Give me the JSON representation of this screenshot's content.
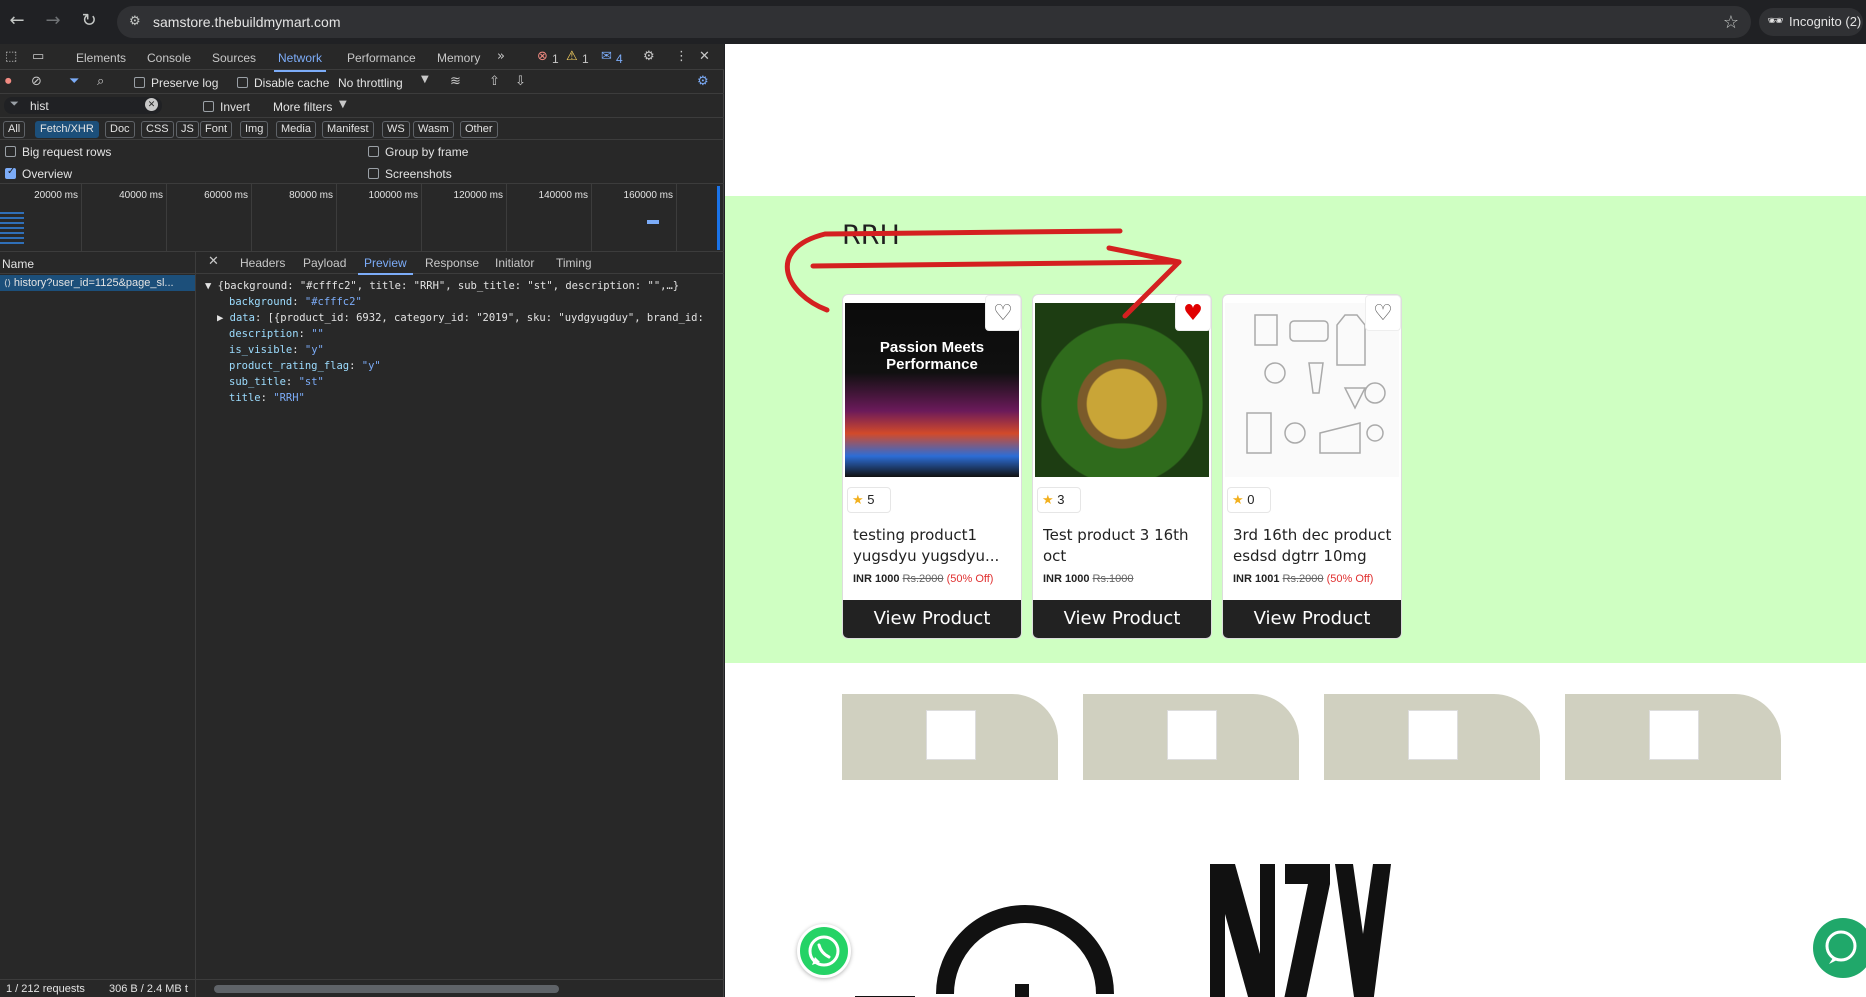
{
  "browser": {
    "url": "samstore.thebuildmymart.com",
    "incognito_label": "Incognito (2)"
  },
  "devtools": {
    "tabs": [
      "Elements",
      "Console",
      "Sources",
      "Network",
      "Performance",
      "Memory"
    ],
    "active_tab": "Network",
    "errors": "1",
    "warnings": "1",
    "messages": "4",
    "toolbar": {
      "preserve_log": "Preserve log",
      "disable_cache": "Disable cache",
      "throttling": "No throttling"
    },
    "filter": {
      "value": "hist",
      "invert": "Invert",
      "more_filters": "More filters"
    },
    "type_filters": [
      "All",
      "Fetch/XHR",
      "Doc",
      "CSS",
      "JS",
      "Font",
      "Img",
      "Media",
      "Manifest",
      "WS",
      "Wasm",
      "Other"
    ],
    "active_type": "Fetch/XHR",
    "options": {
      "big_request_rows": "Big request rows",
      "group_by_frame": "Group by frame",
      "overview": "Overview",
      "screenshots": "Screenshots"
    },
    "overview_ticks": [
      "20000 ms",
      "40000 ms",
      "60000 ms",
      "80000 ms",
      "100000 ms",
      "120000 ms",
      "140000 ms",
      "160000 ms"
    ],
    "name_header": "Name",
    "request_name": "history?user_id=1125&page_sl...",
    "detail_tabs": [
      "Headers",
      "Payload",
      "Preview",
      "Response",
      "Initiator",
      "Timing"
    ],
    "active_detail_tab": "Preview",
    "preview": {
      "summary": "{background: \"#cfffc2\", title: \"RRH\", sub_title: \"st\", description: \"\",…}",
      "lines": [
        {
          "key": "background",
          "value": "\"#cfffc2\""
        },
        {
          "key": "data",
          "value": "[{product_id: 6932, category_id: \"2019\", sku: \"uydgyugduy\", brand_id:"
        },
        {
          "key": "description",
          "value": "\"\""
        },
        {
          "key": "is_visible",
          "value": "\"y\""
        },
        {
          "key": "product_rating_flag",
          "value": "\"y\""
        },
        {
          "key": "sub_title",
          "value": "\"st\""
        },
        {
          "key": "title",
          "value": "\"RRH\""
        }
      ]
    },
    "status": {
      "requests": "1 / 212 requests",
      "size": "306 B / 2.4 MB t"
    }
  },
  "page": {
    "band_color": "#cfffc2",
    "section_title": "RRH",
    "products": [
      {
        "rating": "5",
        "name": "testing product1 yugsdyu yugsdyu...",
        "price": "INR 1000",
        "mrp": "Rs.2000",
        "discount": "(50% Off)",
        "favorited": false,
        "button": "View Product",
        "image_text": "Passion Meets Performance"
      },
      {
        "rating": "3",
        "name": "Test product 3 16th oct",
        "price": "INR 1000",
        "mrp": "Rs.1000",
        "discount": "",
        "favorited": true,
        "button": "View Product"
      },
      {
        "rating": "0",
        "name": "3rd 16th dec product esdsd dgtrr 10mg",
        "price": "INR 1001",
        "mrp": "Rs.2000",
        "discount": "(50% Off)",
        "favorited": false,
        "button": "View Product"
      }
    ],
    "category_tiles": 4,
    "colors": {
      "accent": "#cfffc2",
      "button": "#222222",
      "favorite": "#e00000",
      "discount": "#e03030",
      "whatsapp": "#25d366",
      "annotation": "#d42020"
    }
  }
}
